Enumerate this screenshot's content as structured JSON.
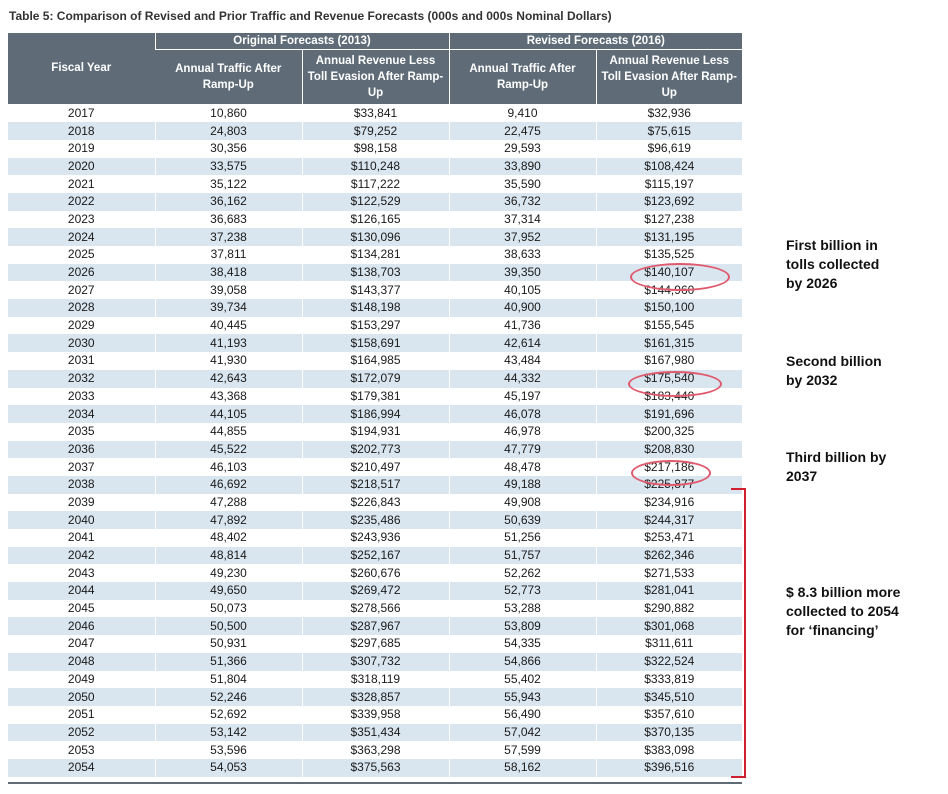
{
  "title": "Table 5: Comparison of Revised and Prior Traffic and Revenue Forecasts (000s and 000s Nominal Dollars)",
  "headers": {
    "fiscal_year": "Fiscal Year",
    "original_group": "Original Forecasts (2013)",
    "revised_group": "Revised Forecasts (2016)",
    "traffic": "Annual Traffic After Ramp-Up",
    "revenue": "Annual Revenue Less Toll Evasion After Ramp-Up"
  },
  "rows": [
    [
      "2017",
      "10,860",
      "$33,841",
      "9,410",
      "$32,936"
    ],
    [
      "2018",
      "24,803",
      "$79,252",
      "22,475",
      "$75,615"
    ],
    [
      "2019",
      "30,356",
      "$98,158",
      "29,593",
      "$96,619"
    ],
    [
      "2020",
      "33,575",
      "$110,248",
      "33,890",
      "$108,424"
    ],
    [
      "2021",
      "35,122",
      "$117,222",
      "35,590",
      "$115,197"
    ],
    [
      "2022",
      "36,162",
      "$122,529",
      "36,732",
      "$123,692"
    ],
    [
      "2023",
      "36,683",
      "$126,165",
      "37,314",
      "$127,238"
    ],
    [
      "2024",
      "37,238",
      "$130,096",
      "37,952",
      "$131,195"
    ],
    [
      "2025",
      "37,811",
      "$134,281",
      "38,633",
      "$135,525"
    ],
    [
      "2026",
      "38,418",
      "$138,703",
      "39,350",
      "$140,107"
    ],
    [
      "2027",
      "39,058",
      "$143,377",
      "40,105",
      "$144,960"
    ],
    [
      "2028",
      "39,734",
      "$148,198",
      "40,900",
      "$150,100"
    ],
    [
      "2029",
      "40,445",
      "$153,297",
      "41,736",
      "$155,545"
    ],
    [
      "2030",
      "41,193",
      "$158,691",
      "42,614",
      "$161,315"
    ],
    [
      "2031",
      "41,930",
      "$164,985",
      "43,484",
      "$167,980"
    ],
    [
      "2032",
      "42,643",
      "$172,079",
      "44,332",
      "$175,540"
    ],
    [
      "2033",
      "43,368",
      "$179,381",
      "45,197",
      "$183,440"
    ],
    [
      "2034",
      "44,105",
      "$186,994",
      "46,078",
      "$191,696"
    ],
    [
      "2035",
      "44,855",
      "$194,931",
      "46,978",
      "$200,325"
    ],
    [
      "2036",
      "45,522",
      "$202,773",
      "47,779",
      "$208,830"
    ],
    [
      "2037",
      "46,103",
      "$210,497",
      "48,478",
      "$217,186"
    ],
    [
      "2038",
      "46,692",
      "$218,517",
      "49,188",
      "$225,877"
    ],
    [
      "2039",
      "47,288",
      "$226,843",
      "49,908",
      "$234,916"
    ],
    [
      "2040",
      "47,892",
      "$235,486",
      "50,639",
      "$244,317"
    ],
    [
      "2041",
      "48,402",
      "$243,936",
      "51,256",
      "$253,471"
    ],
    [
      "2042",
      "48,814",
      "$252,167",
      "51,757",
      "$262,346"
    ],
    [
      "2043",
      "49,230",
      "$260,676",
      "52,262",
      "$271,533"
    ],
    [
      "2044",
      "49,650",
      "$269,472",
      "52,773",
      "$281,041"
    ],
    [
      "2045",
      "50,073",
      "$278,566",
      "53,288",
      "$290,882"
    ],
    [
      "2046",
      "50,500",
      "$287,967",
      "53,809",
      "$301,068"
    ],
    [
      "2047",
      "50,931",
      "$297,685",
      "54,335",
      "$311,611"
    ],
    [
      "2048",
      "51,366",
      "$307,732",
      "54,866",
      "$322,524"
    ],
    [
      "2049",
      "51,804",
      "$318,119",
      "55,402",
      "$333,819"
    ],
    [
      "2050",
      "52,246",
      "$328,857",
      "55,943",
      "$345,510"
    ],
    [
      "2051",
      "52,692",
      "$339,958",
      "56,490",
      "$357,610"
    ],
    [
      "2052",
      "53,142",
      "$351,434",
      "57,042",
      "$370,135"
    ],
    [
      "2053",
      "53,596",
      "$363,298",
      "57,599",
      "$383,098"
    ],
    [
      "2054",
      "54,053",
      "$375,563",
      "58,162",
      "$396,516"
    ]
  ],
  "annotations": {
    "first": "First billion in\ntolls collected\nby 2026",
    "second": "Second billion\nby 2032",
    "third": "Third billion by\n2037",
    "financing": "$ 8.3 billion  more\ncollected to 2054\nfor ‘financing’"
  },
  "colors": {
    "header_bg": "#5f6c78",
    "row_alt": "#d9e6f0",
    "circle": "#e05a6e",
    "bracket": "#d02030"
  }
}
